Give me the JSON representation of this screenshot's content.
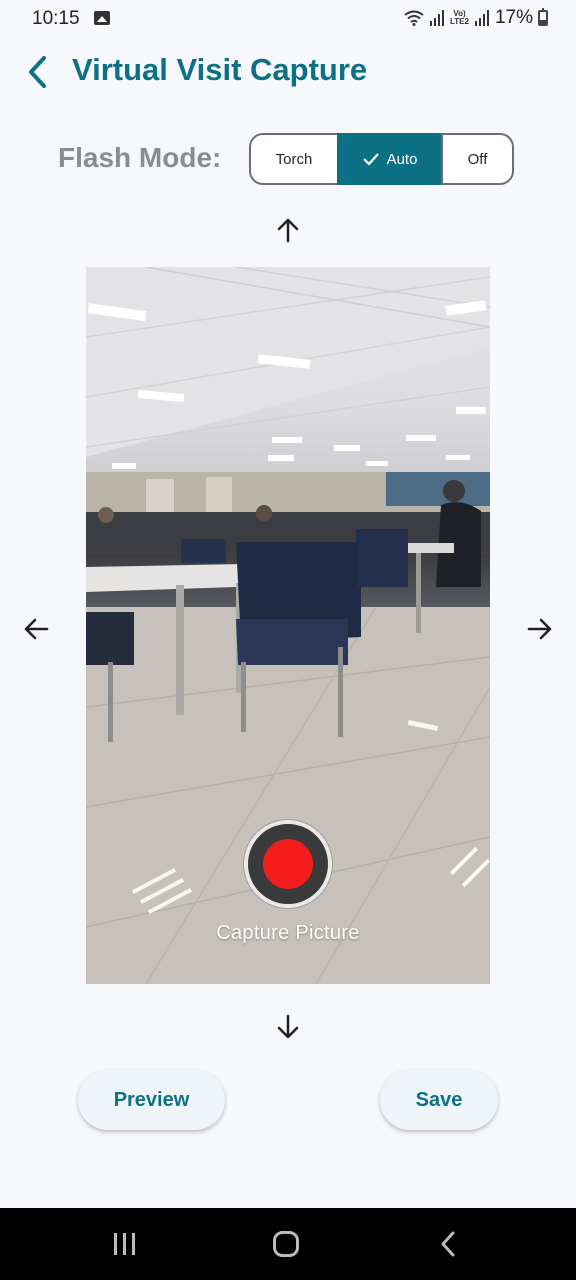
{
  "status_bar": {
    "time": "10:15",
    "network_label": "Vo)\nLTE2",
    "battery_percent": "17%"
  },
  "header": {
    "title": "Virtual Visit Capture",
    "back_icon": "chevron-left-icon",
    "accent_color": "#0d7185"
  },
  "flash": {
    "label": "Flash Mode:",
    "options": [
      {
        "label": "Torch",
        "selected": false
      },
      {
        "label": "Auto",
        "selected": true
      },
      {
        "label": "Off",
        "selected": false
      }
    ]
  },
  "camera": {
    "capture_label": "Capture Picture",
    "capture_color": "#f41c1c"
  },
  "actions": {
    "preview_label": "Preview",
    "save_label": "Save"
  },
  "nav": {
    "icons": [
      "recent-apps-icon",
      "home-icon",
      "back-icon"
    ]
  }
}
